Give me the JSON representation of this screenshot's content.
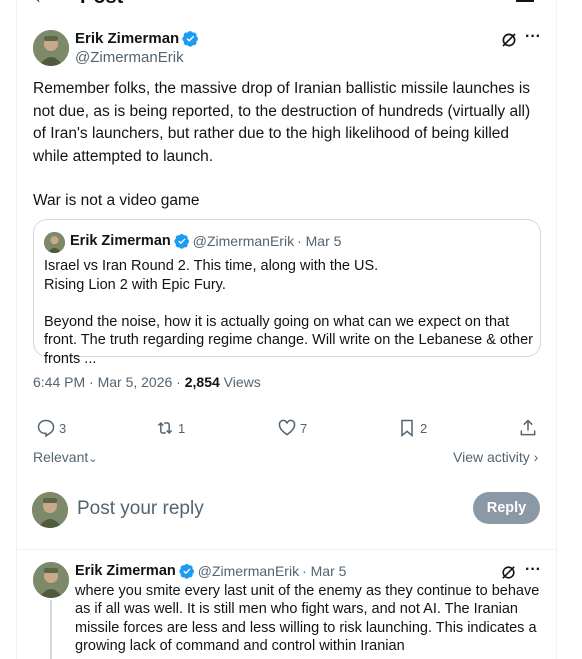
{
  "header": {
    "title": "Post"
  },
  "post": {
    "author_name": "Erik Zimerman",
    "author_handle": "@ZimermanErik",
    "text_p1": "Remember  folks, the massive drop of Iranian ballistic missile launches is not due, as is being reported, to the destruction of hundreds (virtually all) of Iran's launchers, but rather due to the high likelihood of being killed while attempted to launch.",
    "text_p2": "War is not a video game",
    "quote": {
      "author_name": "Erik Zimerman",
      "author_handle": "@ZimermanErik",
      "date": "· Mar 5",
      "line1": "Israel vs Iran Round 2. This time, along with the US.",
      "line2": "Rising Lion 2 with Epic Fury.",
      "line3": "Beyond the noise, how it is actually going on what can we expect on that front. The truth regarding regime change. Will write on the Lebanese & other fronts ..."
    },
    "meta": {
      "time_date": "6:44 PM · Mar 5, 2026 · ",
      "views_count": "2,854",
      "views_label": " Views"
    },
    "actions": {
      "replies": "3",
      "reposts": "1",
      "likes": "7",
      "bookmarks": "2"
    }
  },
  "replies_sort": {
    "label": "Relevant",
    "view_activity": "View activity"
  },
  "reply_composer": {
    "placeholder": "Post your reply",
    "button": "Reply"
  },
  "reply": {
    "author_name": "Erik Zimerman",
    "author_handle": "@ZimermanErik",
    "date": "· Mar 5",
    "text": "where you smite every last unit of the enemy as they continue to behave as if all was well. It is still men who fight wars, and not AI. The Iranian missile forces are less and less willing to risk launching. This indicates a growing lack of command and control within Iranian"
  },
  "colors": {
    "accent": "#1d9bf0",
    "muted": "#536471",
    "reply_button": "#8b98a5"
  }
}
